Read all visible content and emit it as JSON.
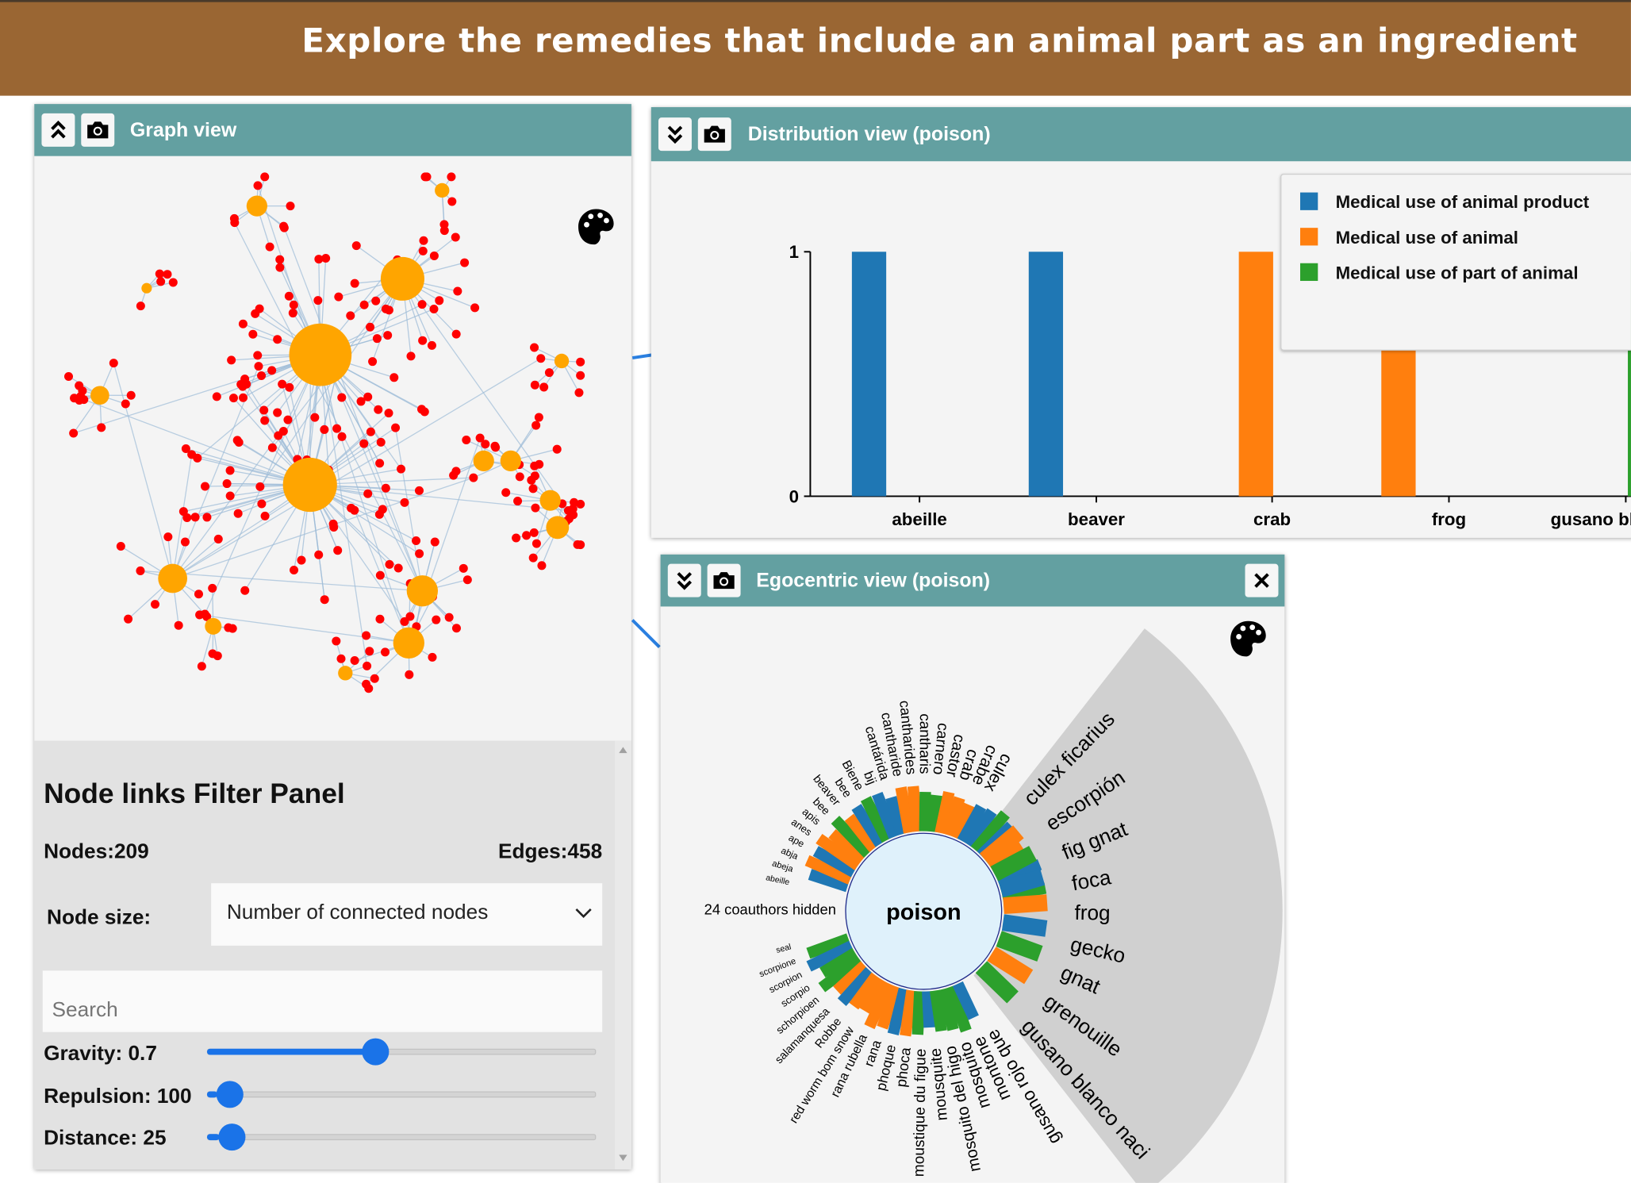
{
  "header": {
    "title": "Explore the remedies that include an animal part as an ingredient"
  },
  "colors": {
    "header_bg": "#9a6633",
    "panel_header": "#63a0a1",
    "node": "#ff0000",
    "hub": "#ffa500",
    "animal_product": "#1f77b4",
    "animal": "#ff7f0e",
    "part_of_animal": "#2ca02c"
  },
  "graph_view": {
    "title": "Graph view",
    "icons": [
      "collapse-up-icon",
      "camera-icon",
      "palette-icon"
    ],
    "filter_panel": {
      "title": "Node links Filter Panel",
      "nodes_label": "Nodes:209",
      "edges_label": "Edges:458",
      "node_size_label": "Node size:",
      "node_size_value": "Number of connected nodes",
      "search_placeholder": "Search",
      "gravity": {
        "label": "Gravity: 0.7",
        "value": 0.7,
        "fraction": 0.44
      },
      "repulsion": {
        "label": "Repulsion: 100",
        "value": 100,
        "fraction": 0.0
      },
      "distance": {
        "label": "Distance: 25",
        "value": 25,
        "fraction": 0.01
      }
    }
  },
  "distribution_view": {
    "title": "Distribution view (poison)",
    "legend": [
      "Medical use of animal product",
      "Medical use of animal",
      "Medical use of part of animal"
    ],
    "chart_data": {
      "type": "bar",
      "categories": [
        "abeille",
        "beaver",
        "crab",
        "frog",
        "gusano blanco na"
      ],
      "series": [
        {
          "name": "Medical use of animal product",
          "values": [
            1,
            1,
            0,
            0,
            0
          ]
        },
        {
          "name": "Medical use of animal",
          "values": [
            0,
            0,
            1,
            1,
            0
          ]
        },
        {
          "name": "Medical use of part of animal",
          "values": [
            0,
            0,
            0,
            0,
            1
          ]
        }
      ],
      "y_ticks": [
        "0",
        "1"
      ],
      "ylim": [
        0,
        1
      ]
    }
  },
  "egocentric_view": {
    "title": "Egocentric view (poison)",
    "center_label": "poison",
    "hidden_label": "24 coauthors hidden",
    "focus_labels": [
      "culex ficarius",
      "escorpión",
      "fig gnat",
      "foca",
      "frog",
      "gecko",
      "gnat",
      "grenouille",
      "gusano blanco naci"
    ],
    "upper_labels": [
      "abeille",
      "abeja",
      "abja",
      "ape",
      "anes",
      "apis",
      "bee",
      "beaver",
      "bee",
      "Biene",
      "bij",
      "cantárida",
      "cantharide",
      "cantharides",
      "cantharis",
      "carnero",
      "castor",
      "crab",
      "crabe",
      "culex"
    ],
    "lower_labels": [
      "seal",
      "scorpione",
      "scorpion",
      "scorpio",
      "schorpioen",
      "salamanquesa",
      "Robbe",
      "red worm bom snow",
      "rana rubella",
      "rana",
      "phoque",
      "phoca",
      "moustique du figue",
      "mousquite",
      "mosquito del higo",
      "mosquito",
      "montone",
      "gusano rojo que"
    ]
  }
}
